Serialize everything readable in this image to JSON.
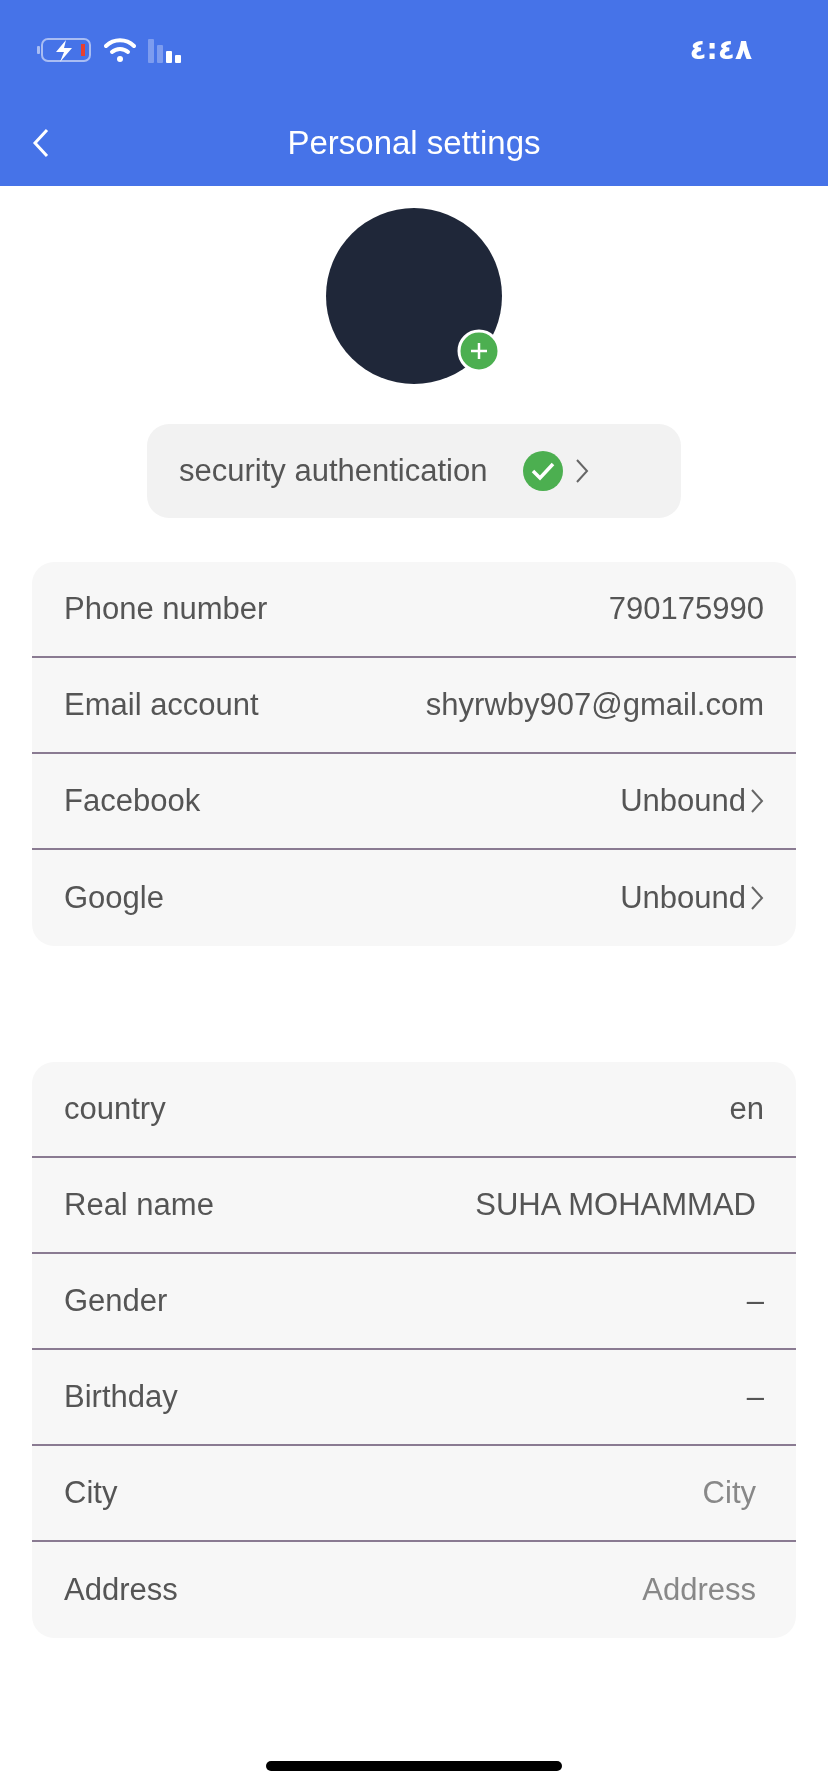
{
  "status_bar": {
    "time": "٤:٤٨"
  },
  "header": {
    "title": "Personal settings"
  },
  "profile": {
    "security": {
      "label": "security authentication",
      "verified": true
    }
  },
  "groups": [
    {
      "rows": [
        {
          "kind": "value",
          "label": "Phone number",
          "value": "790175990"
        },
        {
          "kind": "value",
          "label": "Email account",
          "value": "shyrwby907@gmail.com"
        },
        {
          "kind": "link",
          "label": "Facebook",
          "value": "Unbound"
        },
        {
          "kind": "link",
          "label": "Google",
          "value": "Unbound"
        }
      ]
    },
    {
      "rows": [
        {
          "kind": "value",
          "label": "country",
          "value": "en"
        },
        {
          "kind": "input",
          "label": "Real name",
          "value": "SUHA MOHAMMAD"
        },
        {
          "kind": "value",
          "label": "Gender",
          "value": "–"
        },
        {
          "kind": "value",
          "label": "Birthday",
          "value": "–"
        },
        {
          "kind": "input",
          "label": "City",
          "placeholder": "City"
        },
        {
          "kind": "input",
          "label": "Address",
          "placeholder": "Address"
        }
      ]
    }
  ]
}
